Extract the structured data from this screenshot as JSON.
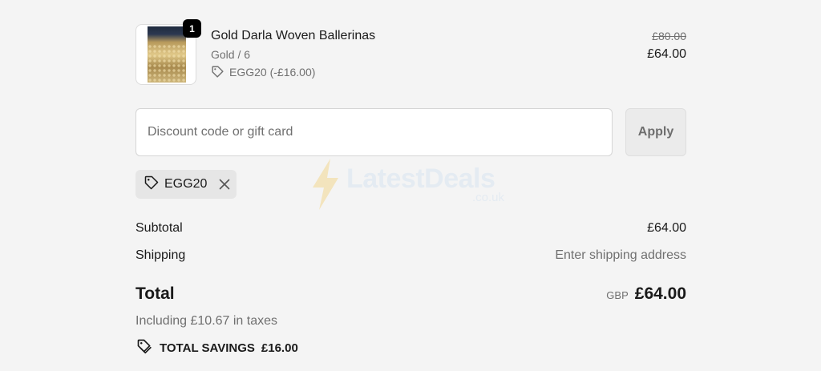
{
  "product": {
    "quantity": "1",
    "name": "Gold Darla Woven Ballerinas",
    "variant": "Gold / 6",
    "discount_line": "EGG20 (-£16.00)",
    "original_price": "£80.00",
    "price": "£64.00"
  },
  "discount": {
    "placeholder": "Discount code or gift card",
    "apply_label": "Apply",
    "applied_code": "EGG20"
  },
  "summary": {
    "subtotal_label": "Subtotal",
    "subtotal_value": "£64.00",
    "shipping_label": "Shipping",
    "shipping_value": "Enter shipping address",
    "total_label": "Total",
    "currency": "GBP",
    "total_value": "£64.00",
    "taxes_note": "Including £10.67 in taxes",
    "savings_label": "TOTAL SAVINGS",
    "savings_value": "£16.00"
  },
  "watermark": {
    "name": "LatestDeals",
    "domain": ".co.uk"
  },
  "icons": {
    "tag": "tag-icon",
    "close": "close-icon",
    "savings": "savings-tag-icon",
    "bolt": "bolt-icon"
  }
}
